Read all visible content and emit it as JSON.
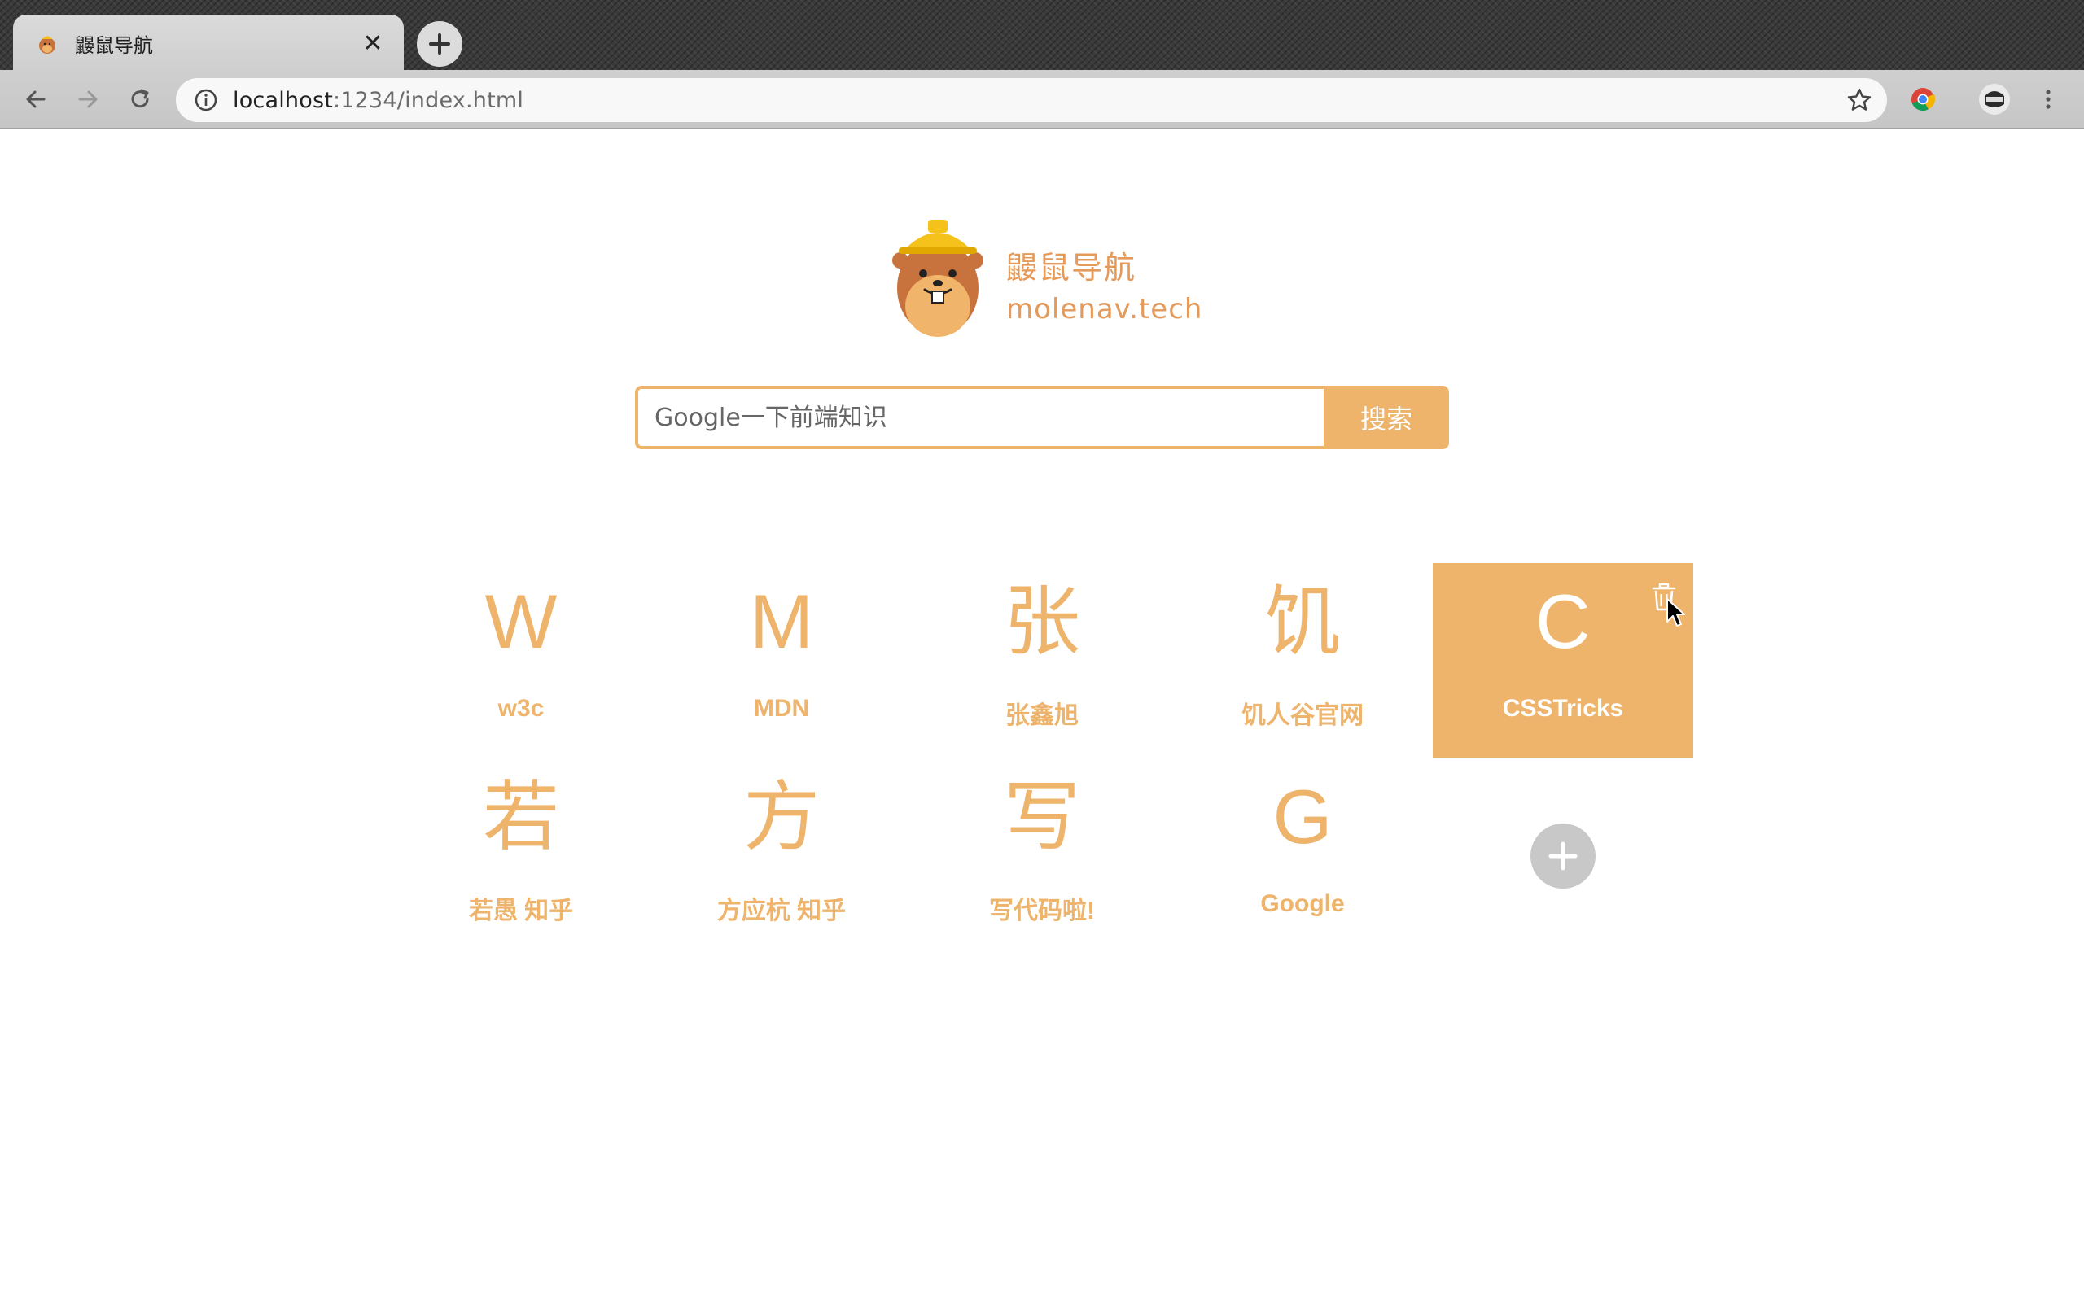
{
  "browser": {
    "tab": {
      "title": "鼹鼠导航",
      "close_label": "✕"
    },
    "new_tab_label": "+",
    "address": {
      "host": "localhost",
      "path": ":1234/index.html"
    }
  },
  "header": {
    "site_name": "鼹鼠导航",
    "domain": "molenav.tech"
  },
  "search": {
    "placeholder": "Google一下前端知识",
    "button_label": "搜索"
  },
  "sites": [
    {
      "letter": "W",
      "label": "w3c"
    },
    {
      "letter": "M",
      "label": "MDN"
    },
    {
      "letter": "张",
      "label": "张鑫旭"
    },
    {
      "letter": "饥",
      "label": "饥人谷官网"
    },
    {
      "letter": "C",
      "label": "CSSTricks"
    },
    {
      "letter": "若",
      "label": "若愚 知乎"
    },
    {
      "letter": "方",
      "label": "方应杭 知乎"
    },
    {
      "letter": "写",
      "label": "写代码啦!"
    },
    {
      "letter": "G",
      "label": "Google"
    }
  ],
  "icons": {
    "delete": "trash-icon",
    "add": "plus-icon"
  },
  "colors": {
    "accent": "#eeb46c",
    "logo_text": "#e59a5a",
    "add_button": "#c8c8c8"
  }
}
